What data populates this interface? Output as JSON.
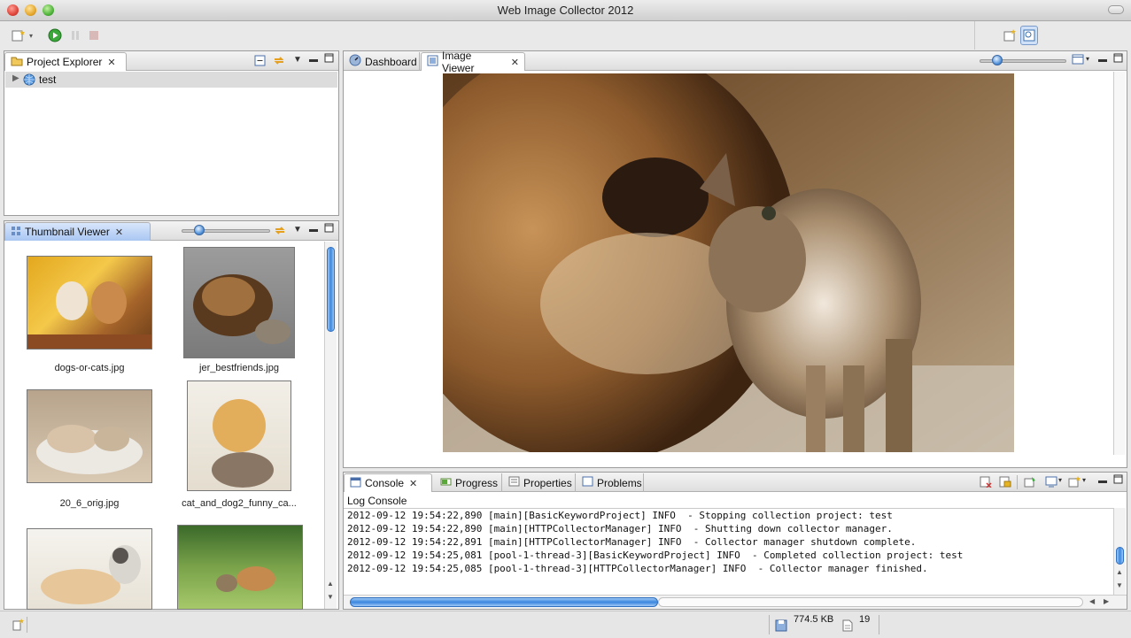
{
  "window": {
    "title": "Web Image Collector 2012"
  },
  "project_explorer": {
    "tab_label": "Project Explorer",
    "tree": [
      {
        "label": "test",
        "expanded": false
      }
    ]
  },
  "thumbnail_viewer": {
    "tab_label": "Thumbnail Viewer",
    "items": [
      {
        "filename": "dogs-or-cats.jpg"
      },
      {
        "filename": "jer_bestfriends.jpg"
      },
      {
        "filename": "20_6_orig.jpg"
      },
      {
        "filename": "cat_and_dog2_funny_ca..."
      },
      {
        "filename": ""
      },
      {
        "filename": ""
      }
    ]
  },
  "editor": {
    "tabs": [
      {
        "label": "Dashboard",
        "active": false
      },
      {
        "label": "Image Viewer",
        "active": true
      }
    ]
  },
  "bottom_panel": {
    "tabs": [
      {
        "label": "Console",
        "active": true
      },
      {
        "label": "Progress",
        "active": false
      },
      {
        "label": "Properties",
        "active": false
      },
      {
        "label": "Problems",
        "active": false
      }
    ],
    "console_title": "Log Console",
    "log_lines": [
      "2012-09-12 19:54:22,890 [main][BasicKeywordProject] INFO  - Stopping collection project: test",
      "2012-09-12 19:54:22,890 [main][HTTPCollectorManager] INFO  - Shutting down collector manager.",
      "2012-09-12 19:54:22,891 [main][HTTPCollectorManager] INFO  - Collector manager shutdown complete.",
      "2012-09-12 19:54:25,081 [pool-1-thread-3][BasicKeywordProject] INFO  - Completed collection project: test",
      "2012-09-12 19:54:25,085 [pool-1-thread-3][HTTPCollectorManager] INFO  - Collector manager finished."
    ]
  },
  "status_bar": {
    "memory": "774.5 KB",
    "file_count": "19"
  },
  "icons": [
    "new-wizard-icon",
    "run-icon",
    "pause-icon",
    "stop-icon",
    "perspective-icon",
    "search-perspective-icon",
    "folder-icon",
    "globe-icon",
    "collapse-all-icon",
    "link-icon",
    "thumbnails-icon",
    "image-icon",
    "dashboard-icon",
    "console-icon",
    "progress-icon",
    "properties-icon",
    "problems-icon",
    "memory-icon",
    "document-icon"
  ],
  "colors": {
    "accent": "#3a86df",
    "active_tab": "#a9c6f2"
  }
}
